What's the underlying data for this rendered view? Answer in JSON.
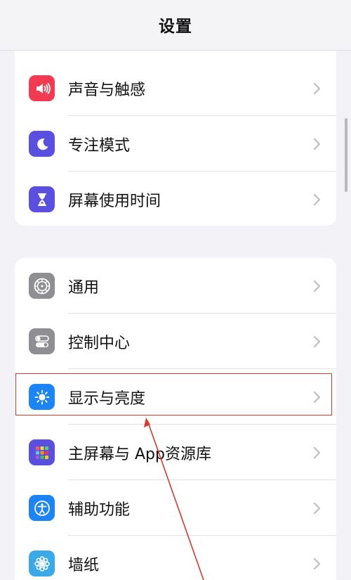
{
  "nav": {
    "title": "设置"
  },
  "groups": [
    {
      "items": [
        {
          "label": "声音与触感",
          "icon": "speaker-icon",
          "color": "#f23a52"
        },
        {
          "label": "专注模式",
          "icon": "moon-icon",
          "color": "#5b4fe0"
        },
        {
          "label": "屏幕使用时间",
          "icon": "hourglass-icon",
          "color": "#5b4fe0"
        }
      ]
    },
    {
      "items": [
        {
          "label": "通用",
          "icon": "gear-icon",
          "color": "#8e8e93"
        },
        {
          "label": "控制中心",
          "icon": "toggles-icon",
          "color": "#8e8e93"
        },
        {
          "label": "显示与亮度",
          "icon": "brightness-icon",
          "color": "#1c84f4"
        },
        {
          "label": "主屏幕与 App资源库",
          "icon": "app-grid-icon",
          "color": "#5b4fe0"
        },
        {
          "label": "辅助功能",
          "icon": "accessibility-icon",
          "color": "#1c84f4"
        },
        {
          "label": "墙纸",
          "icon": "flower-icon",
          "color": "#3aa9e6"
        }
      ]
    }
  ],
  "annotation": {
    "highlight_color": "#d33a2c"
  }
}
